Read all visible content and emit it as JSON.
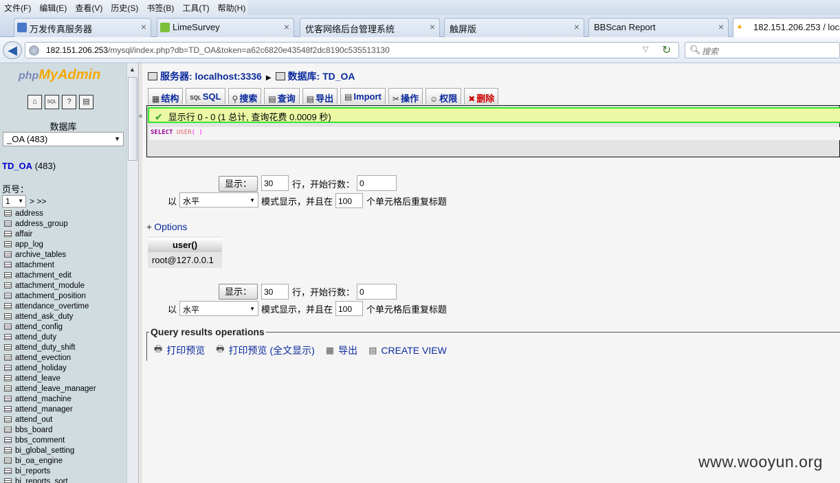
{
  "browser": {
    "menu": [
      "文件(F)",
      "编辑(E)",
      "查看(V)",
      "历史(S)",
      "书签(B)",
      "工具(T)",
      "帮助(H)"
    ],
    "tabs": [
      {
        "label": "万发传真服务器",
        "close": "×"
      },
      {
        "label": "LimeSurvey",
        "close": "×"
      },
      {
        "label": "优客网络后台管理系统",
        "close": "×"
      },
      {
        "label": "触屏版",
        "close": "×"
      },
      {
        "label": "BBScan Report",
        "close": "×"
      },
      {
        "label": "182.151.206.253 / loca",
        "close": ""
      }
    ],
    "url_host": "182.151.206.253",
    "url_path": "/mysql/index.php?db=TD_OA&token=a62c6820e43548f2dc8190c535513130",
    "search_placeholder": "搜索"
  },
  "sidebar": {
    "logo_php": "php",
    "logo_myadmin": "MyAdmin",
    "icons": [
      "home-icon",
      "sql-icon",
      "help-icon",
      "docs-icon"
    ],
    "db_label": "数据库",
    "db_selected": "_OA (483)",
    "db_name": "TD_OA",
    "db_count": "(483)",
    "page_label": "页号：",
    "page_selected": "1",
    "page_nav": "> >>",
    "tables": [
      "address",
      "address_group",
      "affair",
      "app_log",
      "archive_tables",
      "attachment",
      "attachment_edit",
      "attachment_module",
      "attachment_position",
      "attendance_overtime",
      "attend_ask_duty",
      "attend_config",
      "attend_duty",
      "attend_duty_shift",
      "attend_evection",
      "attend_holiday",
      "attend_leave",
      "attend_leave_manager",
      "attend_machine",
      "attend_manager",
      "attend_out",
      "bbs_board",
      "bbs_comment",
      "bi_global_setting",
      "bi_oa_engine",
      "bi_reports",
      "bi_reports_sort"
    ]
  },
  "main": {
    "breadcrumb": {
      "server": "服务器: localhost:3336",
      "database": "数据库: TD_OA"
    },
    "tabs": [
      {
        "label": "结构",
        "icon": "structure-icon"
      },
      {
        "label": "SQL",
        "icon": "sql-icon"
      },
      {
        "label": "搜索",
        "icon": "search-icon"
      },
      {
        "label": "查询",
        "icon": "query-icon"
      },
      {
        "label": "导出",
        "icon": "export-icon"
      },
      {
        "label": "Import",
        "icon": "import-icon"
      },
      {
        "label": "操作",
        "icon": "operations-icon"
      },
      {
        "label": "权限",
        "icon": "privileges-icon"
      },
      {
        "label": "删除",
        "icon": "drop-icon"
      }
    ],
    "notice": "显示行 0 - 0 (1 总计, 查询花费 0.0009 秒)",
    "sql": {
      "keyword": "SELECT",
      "func": "USER",
      "parens": "( )"
    },
    "nav_top": {
      "button": "显示：",
      "rows": "30",
      "start_label": "行，开始行数：",
      "start": "0",
      "mode_prefix": "以",
      "mode": "水平",
      "mode_suffix": "模式显示，并且在",
      "repeat": "100",
      "repeat_suffix": "个单元格后重复标题"
    },
    "nav_bottom": {
      "button": "显示：",
      "rows": "30",
      "start_label": "行，开始行数：",
      "start": "0",
      "mode_prefix": "以",
      "mode": "水平",
      "mode_suffix": "模式显示，并且在",
      "repeat": "100",
      "repeat_suffix": "个单元格后重复标题"
    },
    "options_label": "Options",
    "result": {
      "column": "user()",
      "value": "root@127.0.0.1"
    },
    "qro": {
      "legend": "Query results operations",
      "links": [
        "打印预览",
        "打印预览 (全文显示)",
        "导出",
        "CREATE VIEW"
      ]
    }
  },
  "watermark": "www.wooyun.org",
  "colors": {
    "link": "#0a2a9c",
    "notice_bg": "#ebf8a4",
    "notice_border": "#32e630",
    "sidebar_bg": "#d0dce0",
    "drop": "#cc0000"
  }
}
